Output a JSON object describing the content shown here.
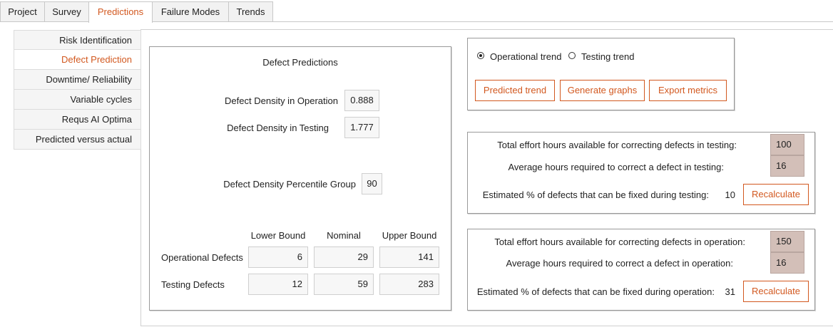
{
  "tabs": [
    {
      "label": "Project"
    },
    {
      "label": "Survey"
    },
    {
      "label": "Predictions",
      "active": true
    },
    {
      "label": "Failure Modes"
    },
    {
      "label": "Trends"
    }
  ],
  "sidebar": {
    "items": [
      {
        "label": "Risk Identification"
      },
      {
        "label": "Defect Prediction",
        "active": true
      },
      {
        "label": "Downtime/ Reliability"
      },
      {
        "label": "Variable cycles"
      },
      {
        "label": "Requs AI Optima"
      },
      {
        "label": "Predicted versus actual"
      }
    ]
  },
  "defect_panel": {
    "title": "Defect Predictions",
    "density_operation_label": "Defect Density in Operation",
    "density_operation_value": "0.888",
    "density_testing_label": "Defect Density in Testing",
    "density_testing_value": "1.777",
    "percentile_label": "Defect Density Percentile Group",
    "percentile_value": "90",
    "columns": [
      "Lower Bound",
      "Nominal",
      "Upper Bound"
    ],
    "rows": [
      {
        "label": "Operational Defects",
        "values": [
          "6",
          "29",
          "141"
        ]
      },
      {
        "label": "Testing Defects",
        "values": [
          "12",
          "59",
          "283"
        ]
      }
    ]
  },
  "trend_panel": {
    "radio_operational": "Operational trend",
    "radio_testing": "Testing trend",
    "selected": "Operational trend",
    "buttons": {
      "predicted": "Predicted trend",
      "graphs": "Generate graphs",
      "export": "Export metrics"
    }
  },
  "testing_panel": {
    "effort_label": "Total effort hours available for correcting defects in testing:",
    "effort_value": "100",
    "avg_label": "Average hours required to correct a defect in testing:",
    "avg_value": "16",
    "estimate_label": "Estimated % of defects that can be fixed during testing:",
    "estimate_value": "10",
    "recalc_label": "Recalculate"
  },
  "operation_panel": {
    "effort_label": "Total effort hours available for correcting defects in operation:",
    "effort_value": "150",
    "avg_label": "Average hours required to correct a defect in operation:",
    "avg_value": "16",
    "estimate_label": "Estimated % of defects that can be fixed during operation:",
    "estimate_value": "31",
    "recalc_label": "Recalculate"
  },
  "colors": {
    "accent": "#d2581f",
    "effort_input_bg": "#d3bfb8"
  }
}
